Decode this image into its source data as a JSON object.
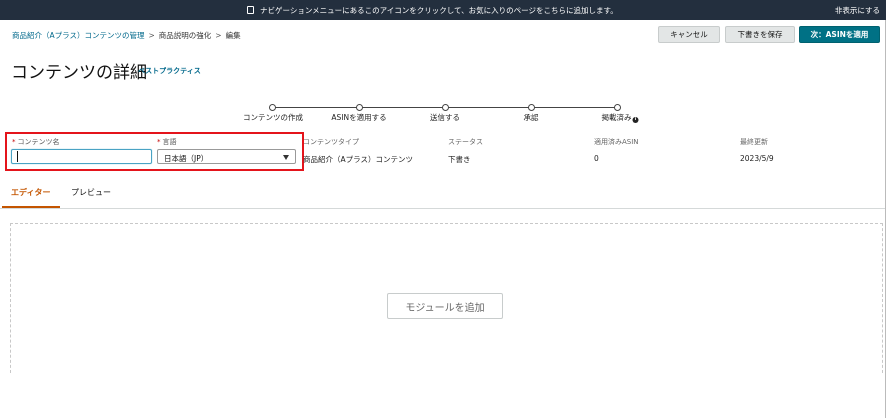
{
  "topbar": {
    "message": "ナビゲーションメニューにあるこのアイコンをクリックして、お気に入りのページをこちらに追加します。",
    "hide_label": "非表示にする"
  },
  "breadcrumb": {
    "items": [
      "商品紹介（Aプラス）コンテンツの管理",
      "商品説明の強化",
      "編集"
    ],
    "separator": ">"
  },
  "header_buttons": {
    "cancel": "キャンセル",
    "save_draft": "下書きを保存",
    "next": "次：ASINを適用"
  },
  "page": {
    "title": "コンテンツの詳細",
    "best_practices": "ベストプラクティス"
  },
  "steps": [
    {
      "label": "コンテンツの作成"
    },
    {
      "label": "ASINを適用する"
    },
    {
      "label": "送信する"
    },
    {
      "label": "承認"
    },
    {
      "label": "掲載済み"
    }
  ],
  "info_glyph": "i",
  "form": {
    "required_mark": "*",
    "content_name_label": "コンテンツ名",
    "content_name_value": "",
    "language_label": "言語",
    "language_value": "日本語（JP）"
  },
  "meta": {
    "content_type_label": "コンテンツタイプ",
    "content_type_value": "商品紹介（Aプラス）コンテンツ",
    "status_label": "ステータス",
    "status_value": "下書き",
    "applied_asin_label": "適用済みASIN",
    "applied_asin_value": "0",
    "last_updated_label": "最終更新",
    "last_updated_value": "2023/5/9"
  },
  "tabs": [
    {
      "label": "エディター",
      "active": true
    },
    {
      "label": "プレビュー",
      "active": false
    }
  ],
  "editor": {
    "add_module_label": "モジュールを追加"
  },
  "colors": {
    "topbar_bg": "#232f3e",
    "primary_button": "#007185",
    "active_tab": "#c45500",
    "highlight": "#e4141b",
    "link": "#00688b"
  }
}
